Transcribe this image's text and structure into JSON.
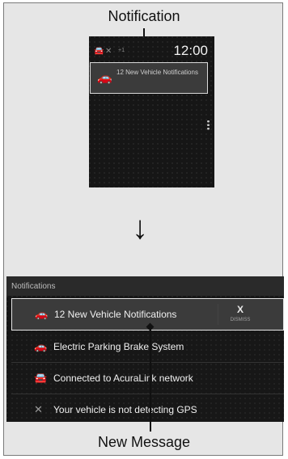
{
  "top_callout": {
    "label": "Notification"
  },
  "phone": {
    "clock": "12:00",
    "status_icons": [
      "car-signal-icon",
      "gps-off-icon",
      "plus-one-badge"
    ],
    "status_badge": "+1",
    "notification_text": "12 New Vehicle Notifications"
  },
  "arrow": {
    "glyph": "↓"
  },
  "notifications_panel": {
    "header": "Notifications",
    "items": [
      {
        "label": "12 New Vehicle Notifications",
        "icon": "car-alert-icon",
        "selected": true
      },
      {
        "label": "Electric Parking Brake System",
        "icon": "car-alert-icon",
        "selected": false
      },
      {
        "label": "Connected to AcuraLink network",
        "icon": "network-car-icon",
        "selected": false
      },
      {
        "label": "Your vehicle is not detecting GPS",
        "icon": "gps-off-icon",
        "selected": false
      }
    ],
    "dismiss": {
      "x": "X",
      "label": "DISMISS"
    }
  },
  "bottom_callout": {
    "label": "New Message"
  },
  "colors": {
    "screen_bg": "#161616",
    "highlight_bg": "#3b3b3b",
    "highlight_border": "#e5e5e5"
  }
}
